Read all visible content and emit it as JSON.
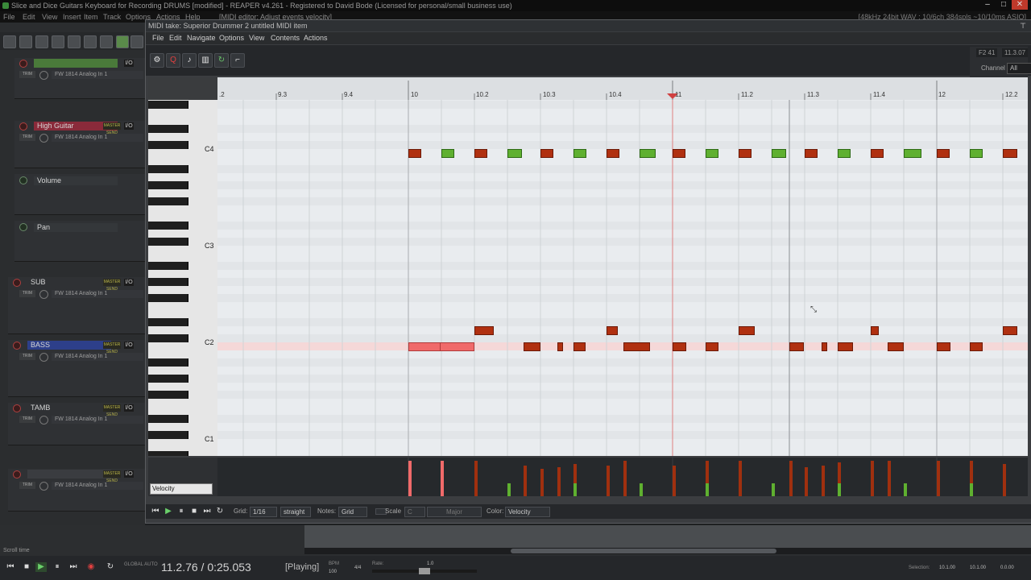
{
  "main_window": {
    "title": "Slice and Dice Guitars Keyboard for Recording DRUMS [modified] - REAPER v4.261 - Registered to David Bode (Licensed for personal/small business use)",
    "menu": [
      "File",
      "Edit",
      "View",
      "Insert",
      "Item",
      "Track",
      "Options",
      "Actions",
      "Help",
      "[MIDI editor: Adjust events velocity]"
    ],
    "status": "[48kHz 24bit WAV : 10/6ch 384spls ~10/10ms ASIO]"
  },
  "tracks": [
    {
      "name": "",
      "color": "#4a7a3a",
      "input": "FW 1814 Analog In 1"
    },
    {
      "name": "High Guitar",
      "color": "#8a2a3a",
      "input": "FW 1814 Analog In 1"
    },
    {
      "name": "Volume",
      "color": "",
      "input": ""
    },
    {
      "name": "Pan",
      "color": "",
      "input": ""
    },
    {
      "name": "SUB",
      "color": "",
      "input": "FW 1814 Analog In 1"
    },
    {
      "name": "BASS",
      "color": "#2d3f8a",
      "input": "FW 1814 Analog In 1"
    },
    {
      "name": "TAMB",
      "color": "",
      "input": "FW 1814 Analog In 1"
    },
    {
      "name": "",
      "color": "",
      "input": "FW 1814 Analog In 1"
    }
  ],
  "track_labels": {
    "io": "I/O",
    "master_send": "MASTER SEND",
    "trim": "TRIM"
  },
  "midi_editor": {
    "title": "MIDI take: Superior Drummer 2 untitled MIDI item",
    "menu": [
      "File",
      "Edit",
      "Navigate",
      "Options",
      "View",
      "Contents",
      "Actions"
    ],
    "position": [
      "F2 41",
      "11.3.07"
    ],
    "channel_label": "Channel",
    "channel_value": "All",
    "ruler": [
      ".2",
      "9.3",
      "9.4",
      "10",
      "10.2",
      "10.3",
      "10.4",
      "11",
      "11.2",
      "11.3",
      "11.4",
      "12",
      "12.2"
    ],
    "key_labels": [
      "C4",
      "C3",
      "C2",
      "C1"
    ],
    "cc_lane": "Velocity",
    "bottom": {
      "grid_label": "Grid:",
      "grid_value": "1/16",
      "swing_value": "straight",
      "notes_label": "Notes:",
      "notes_value": "Grid",
      "scale_label": "Scale",
      "scale_root": "C",
      "scale_value": "Major",
      "color_label": "Color:",
      "color_value": "Velocity"
    }
  },
  "transport": {
    "time": "11.2.76 / 0:25.053",
    "state": "[Playing]",
    "bpm_label": "BPM",
    "bpm": "100",
    "time_sig": "4/4",
    "rate_label": "Rate:",
    "rate": "1.0",
    "global_auto": "GLOBAL AUTO",
    "scroll_time": "Scroll time",
    "selection_label": "Selection:",
    "selection": [
      "10.1.00",
      "10.1.00",
      "0.0.00"
    ]
  }
}
